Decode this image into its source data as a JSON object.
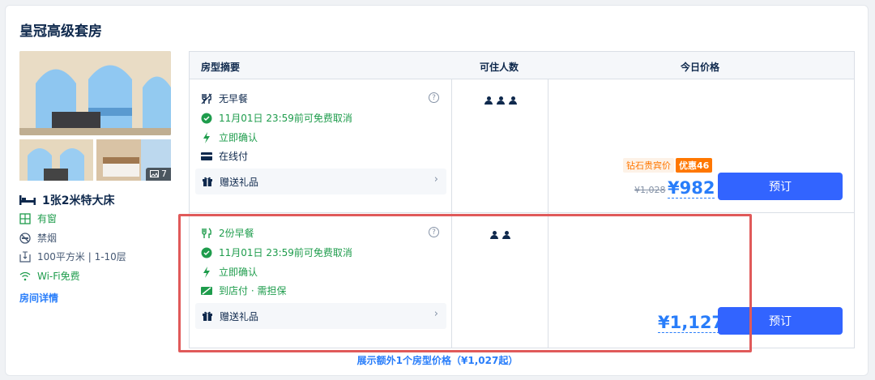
{
  "room": {
    "title": "皇冠高级套房",
    "photo_count": "7",
    "bed": "1张2米特大床",
    "features": [
      "有窗",
      "禁烟",
      "100平方米 | 1-10层",
      "Wi-Fi免费"
    ],
    "detail_link": "房间详情"
  },
  "table": {
    "headers": [
      "房型摘要",
      "可住人数",
      "今日价格"
    ],
    "rows": [
      {
        "meal": "无早餐",
        "cancel": "11月01日 23:59前可免费取消",
        "confirm": "立即确认",
        "payment": "在线付",
        "gift": "赠送礼品",
        "occupancy": 3,
        "badge_vip": "钻石贵宾价",
        "badge_discount": "优惠46",
        "original_price": "¥1,028",
        "price": "¥982",
        "book_label": "预订"
      },
      {
        "meal": "2份早餐",
        "cancel": "11月01日 23:59前可免费取消",
        "confirm": "立即确认",
        "payment": "到店付 · 需担保",
        "gift": "赠送礼品",
        "occupancy": 2,
        "price": "¥1,127",
        "book_label": "预订"
      }
    ]
  },
  "more_link": "展示额外1个房型价格（¥1,027起）",
  "colors": {
    "accent": "#287dfa",
    "button": "#3264ff",
    "green": "#1e9c4c",
    "orange": "#ff7700",
    "highlight": "#e05a5a"
  }
}
